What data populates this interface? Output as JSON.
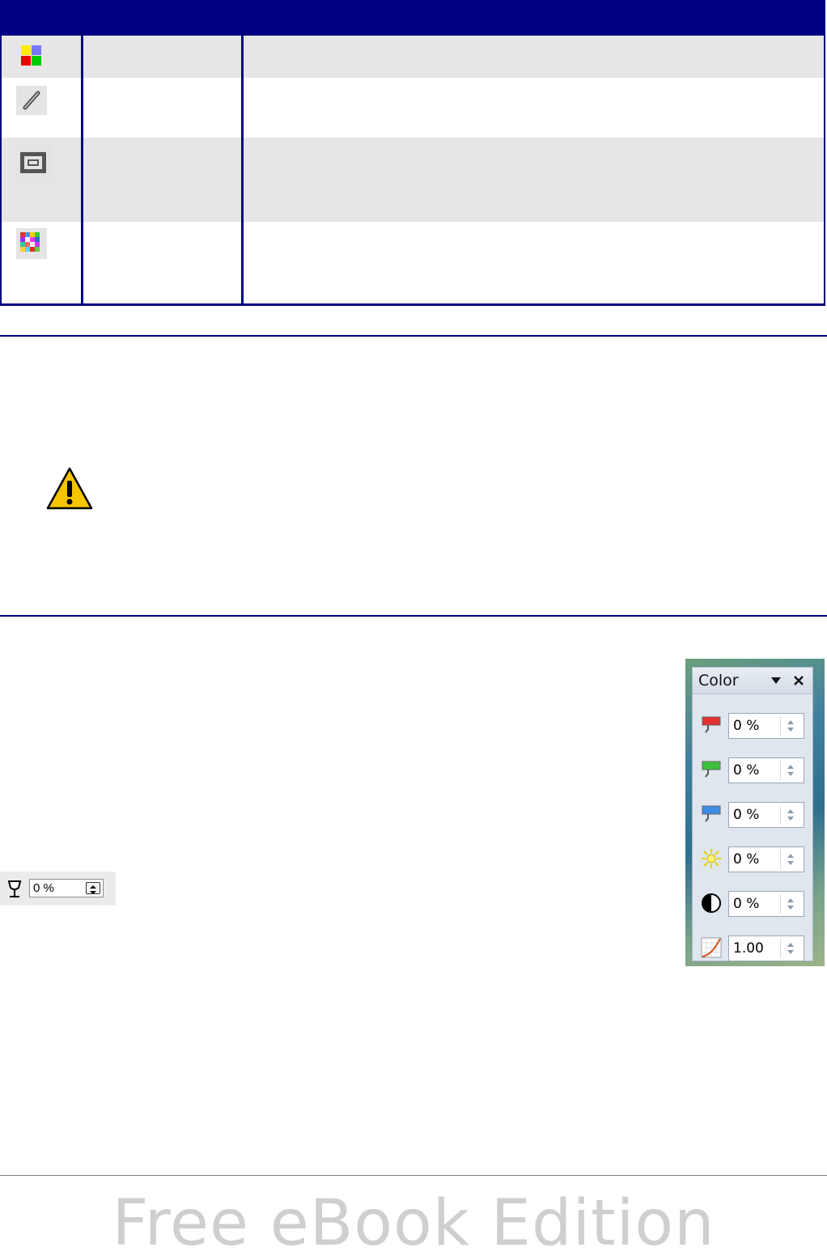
{
  "table": {
    "rows": [
      {
        "icon": "color-toolbar-icon"
      },
      {
        "icon": "line-pencil-icon"
      },
      {
        "icon": "area-frame-icon"
      },
      {
        "icon": "mosaic-filter-icon"
      }
    ]
  },
  "caution": {
    "icon": "warning-triangle-icon"
  },
  "transparency": {
    "icon": "transparency-glass-icon",
    "value": "0 %"
  },
  "color_panel": {
    "title": "Color",
    "rows": [
      {
        "icon": "red-channel-icon",
        "value": "0 %"
      },
      {
        "icon": "green-channel-icon",
        "value": "0 %"
      },
      {
        "icon": "blue-channel-icon",
        "value": "0 %"
      },
      {
        "icon": "brightness-icon",
        "value": "0 %"
      },
      {
        "icon": "contrast-icon",
        "value": "0 %"
      },
      {
        "icon": "gamma-icon",
        "value": "1.00"
      }
    ]
  },
  "footer": {
    "watermark": "Free eBook Edition"
  },
  "colors": {
    "navy": "#000080",
    "row_grey": "#e6e6e6",
    "warning_yellow": "#f6c400"
  }
}
